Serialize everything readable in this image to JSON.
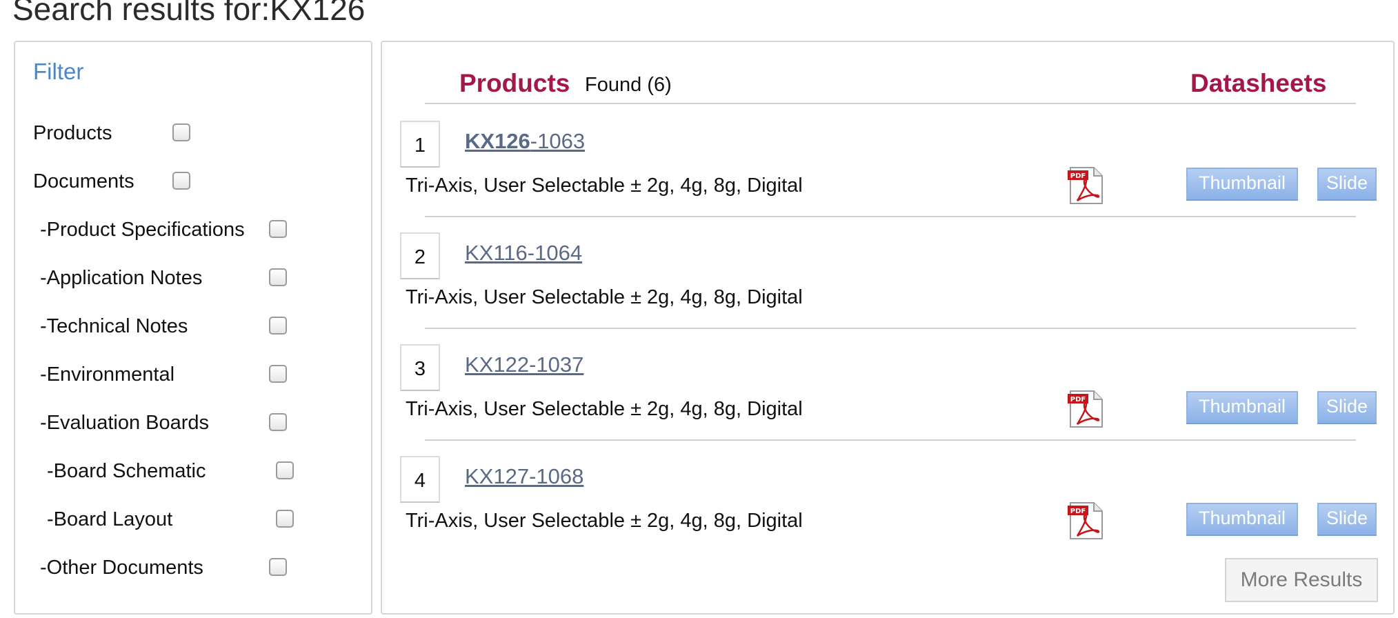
{
  "page": {
    "title": "Search results for:KX126"
  },
  "filter": {
    "heading": "Filter",
    "items": [
      {
        "label": "Products",
        "checked": false
      },
      {
        "label": "Documents",
        "checked": false
      },
      {
        "label": "-Product Specifications",
        "checked": false
      },
      {
        "label": "-Application Notes",
        "checked": false
      },
      {
        "label": "-Technical Notes",
        "checked": false
      },
      {
        "label": "-Environmental",
        "checked": false
      },
      {
        "label": "-Evaluation Boards",
        "checked": false
      },
      {
        "label": "-Board Schematic",
        "checked": false
      },
      {
        "label": "-Board Layout",
        "checked": false
      },
      {
        "label": "-Other Documents",
        "checked": false
      }
    ]
  },
  "results": {
    "products_heading": "Products",
    "found_label": "Found (6)",
    "datasheets_heading": "Datasheets",
    "rows": [
      {
        "rank": "1",
        "part_bold": "KX126",
        "part_rest": "-1063",
        "description": "Tri-Axis, User Selectable ± 2g, 4g, 8g, Digital",
        "has_datasheet": true,
        "thumbnail_label": "Thumbnail",
        "slide_label": "Slide",
        "pdf_icon": "pdf-icon"
      },
      {
        "rank": "2",
        "part_bold": "",
        "part_rest": "KX116-1064",
        "description": "Tri-Axis, User Selectable ± 2g, 4g, 8g, Digital",
        "has_datasheet": false
      },
      {
        "rank": "3",
        "part_bold": "",
        "part_rest": "KX122-1037",
        "description": "Tri-Axis, User Selectable ± 2g, 4g, 8g, Digital",
        "has_datasheet": true,
        "thumbnail_label": "Thumbnail",
        "slide_label": "Slide",
        "pdf_icon": "pdf-icon"
      },
      {
        "rank": "4",
        "part_bold": "",
        "part_rest": "KX127-1068",
        "description": "Tri-Axis, User Selectable ± 2g, 4g, 8g, Digital",
        "has_datasheet": true,
        "thumbnail_label": "Thumbnail",
        "slide_label": "Slide",
        "pdf_icon": "pdf-icon"
      }
    ],
    "more_results_label": "More Results"
  },
  "colors": {
    "filter_heading": "#4a86c8",
    "section_heading": "#a4174b",
    "link": "#5a6a86",
    "button_blue": "#8db2e8"
  }
}
